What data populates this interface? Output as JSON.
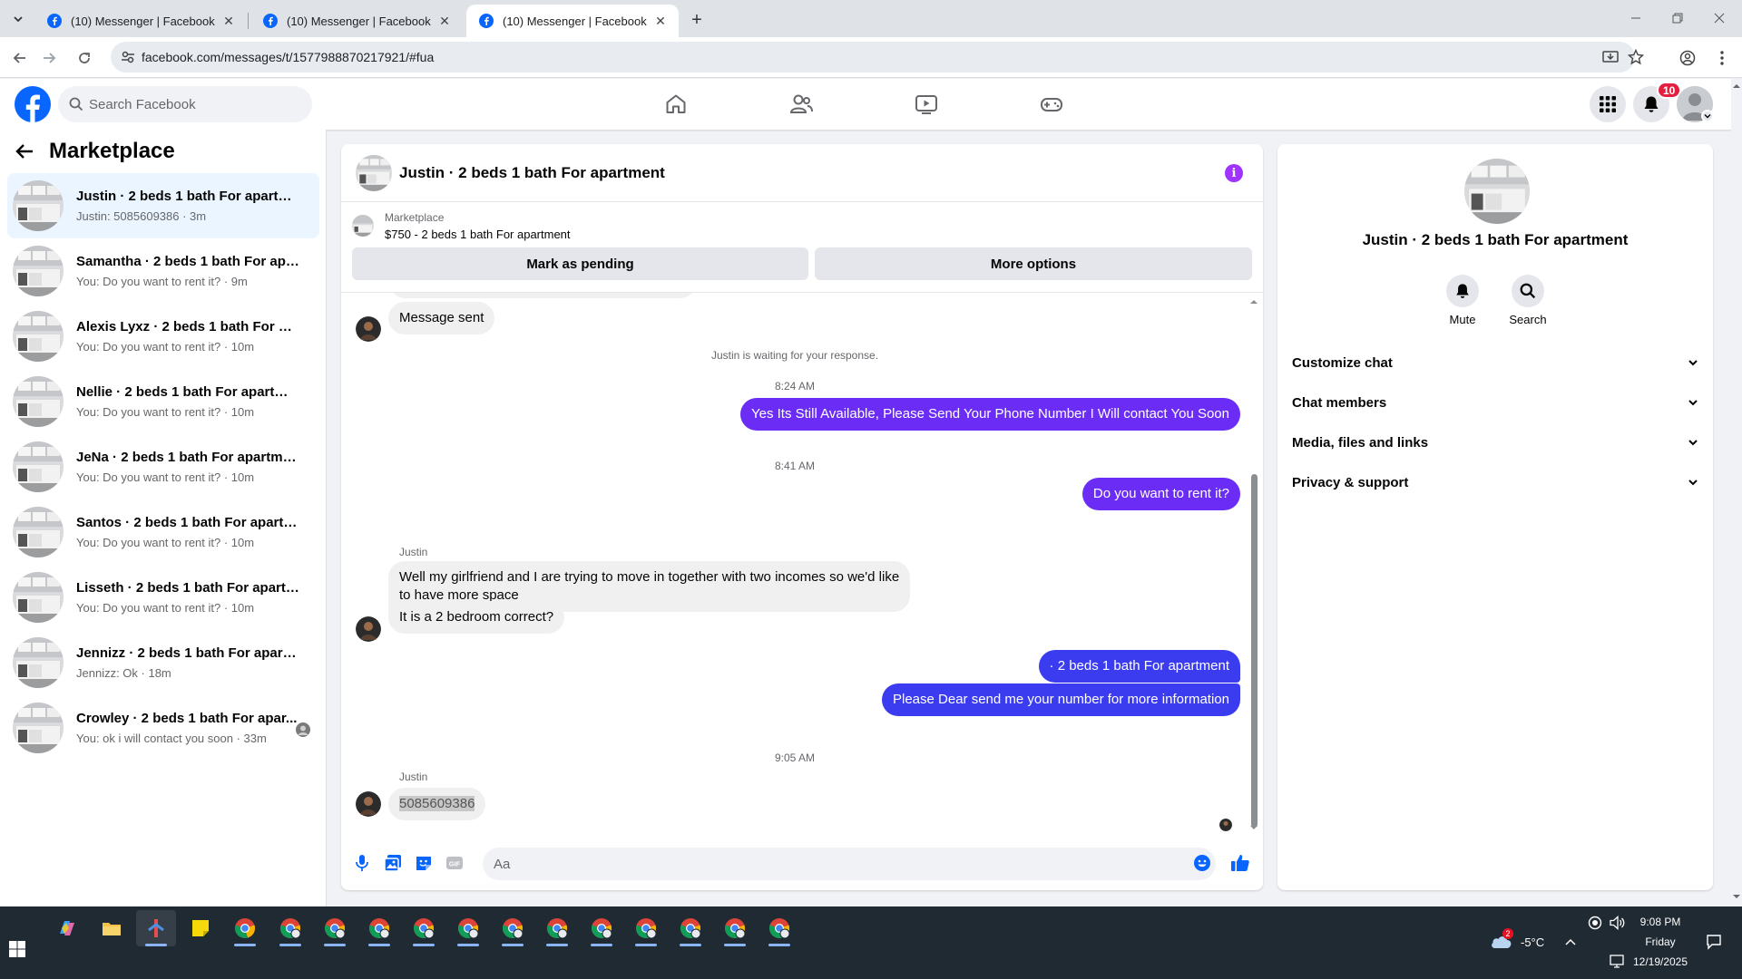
{
  "browser": {
    "tabs": [
      {
        "title": "(10) Messenger | Facebook",
        "active": false
      },
      {
        "title": "(10) Messenger | Facebook",
        "active": false
      },
      {
        "title": "(10) Messenger | Facebook",
        "active": true
      }
    ],
    "url": "facebook.com/messages/t/1577988870217921/#fua"
  },
  "fb": {
    "search_placeholder": "Search Facebook",
    "notifications_count": "10",
    "colors": {
      "brand": "#0866ff",
      "outgoing": "#6b2cf5",
      "outgoing_alt": "#3b3cf0"
    }
  },
  "sidebar": {
    "title": "Marketplace",
    "conversations": [
      {
        "title": "Justin · 2 beds 1 bath For apartment",
        "subtitle": "Justin: 5085609386 · 3m",
        "active": true
      },
      {
        "title": "Samantha · 2 beds 1 bath For apar...",
        "subtitle": "You: Do you want to rent it? · 9m"
      },
      {
        "title": "Alexis Lyxz · 2 beds 1 bath For apar...",
        "subtitle": "You: Do you want to rent it? · 10m"
      },
      {
        "title": "Nellie · 2 beds 1 bath For apartment",
        "subtitle": "You: Do you want to rent it? · 10m"
      },
      {
        "title": "JeNa · 2 beds 1 bath For apartment",
        "subtitle": "You: Do you want to rent it? · 10m"
      },
      {
        "title": "Santos · 2 beds 1 bath For apartme...",
        "subtitle": "You: Do you want to rent it? · 10m"
      },
      {
        "title": "Lisseth · 2 beds 1 bath For apartme...",
        "subtitle": "You: Do you want to rent it? · 10m"
      },
      {
        "title": "Jennizz · 2 beds 1 bath For apartm...",
        "subtitle": "Jennizz: Ok · 18m"
      },
      {
        "title": "Crowley · 2 beds 1 bath For apar...",
        "subtitle": "You: ok i will contact you soon · 33m"
      }
    ]
  },
  "chat": {
    "title": "Justin · 2 beds 1 bath For apartment",
    "marketplace_label": "Marketplace",
    "item": "$750 - 2 beds 1 bath For apartment",
    "mark_pending": "Mark as pending",
    "more_options": "More options",
    "messages": {
      "msg_sent": "Message sent",
      "waiting": "Justin is waiting for your response.",
      "time1": "8:24 AM",
      "out1": "Yes Its Still Available, Please Send Your Phone Number I Will contact You Soon",
      "time2": "8:41 AM",
      "out2": "Do you want to rent it?",
      "sender1": "Justin",
      "in1_line1": "Well my girlfriend and I are trying to move in together with two incomes so we'd like",
      "in1_line2": "to have more space",
      "in2": "It is a 2 bedroom correct?",
      "out3": "· 2 beds 1 bath For apartment",
      "out4": "Please Dear send me your number for more information",
      "time3": "9:05 AM",
      "sender2": "Justin",
      "in3": "5085609386"
    },
    "composer_placeholder": "Aa"
  },
  "info_panel": {
    "name": "Justin · 2 beds 1 bath For apartment",
    "mute": "Mute",
    "search": "Search",
    "sections": [
      "Customize chat",
      "Chat members",
      "Media, files and links",
      "Privacy & support"
    ]
  },
  "taskbar": {
    "weather": "-5°C",
    "weather_badge": "2",
    "time": "9:08 PM",
    "day": "Friday",
    "date": "12/19/2025"
  }
}
